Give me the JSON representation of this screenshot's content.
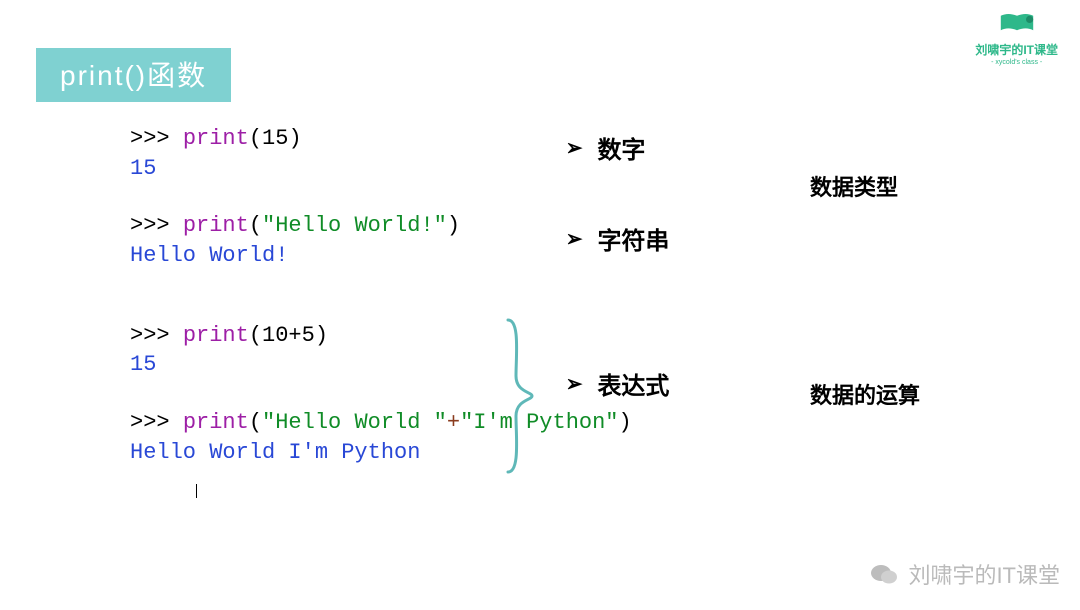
{
  "title": "print()函数",
  "logo": {
    "text": "刘啸宇的IT课堂",
    "sub": "- xycold's class -"
  },
  "code": {
    "b1": {
      "prompt": ">>> ",
      "fn": "print",
      "lp": "(",
      "arg": "15",
      "rp": ")",
      "out": "15"
    },
    "b2": {
      "prompt": ">>> ",
      "fn": "print",
      "lp": "(",
      "arg": "\"Hello World!\"",
      "rp": ")",
      "out": "Hello World!"
    },
    "b3": {
      "prompt": ">>> ",
      "fn": "print",
      "lp": "(",
      "arg": "10+5",
      "rp": ")",
      "out": "15"
    },
    "b4": {
      "prompt": ">>> ",
      "fn": "print",
      "lp": "(",
      "s1": "\"Hello World \"",
      "plus": "+",
      "s2": "\"I'm Python\"",
      "rp": ")",
      "out": "Hello World I'm Python"
    }
  },
  "bullets": {
    "arrow": "➢",
    "num": "数字",
    "str": "字符串",
    "expr": "表达式"
  },
  "annotations": {
    "datatype": "数据类型",
    "dataop": "数据的运算"
  },
  "watermark": "刘啸宇的IT课堂"
}
